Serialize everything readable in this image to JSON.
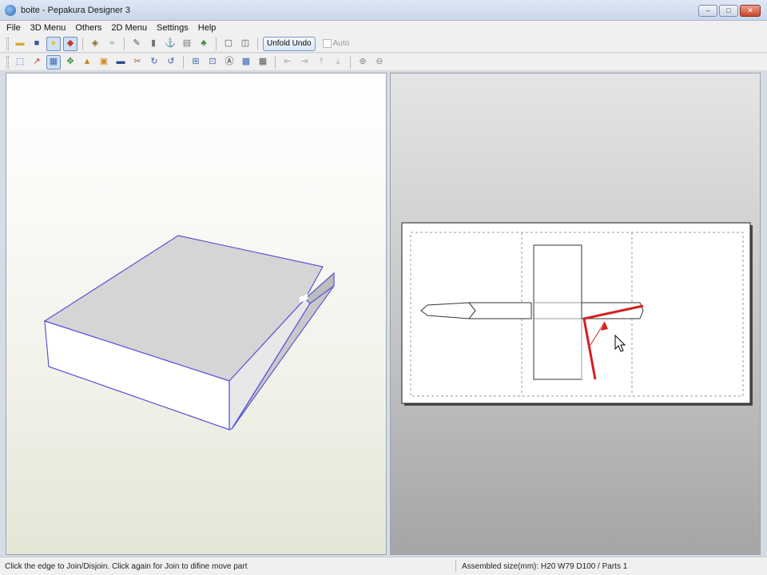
{
  "window": {
    "title": "boite - Pepakura Designer 3",
    "controls": {
      "minimize": "–",
      "maximize": "□",
      "close": "✕"
    }
  },
  "menu": [
    "File",
    "3D Menu",
    "Others",
    "2D Menu",
    "Settings",
    "Help"
  ],
  "toolbar1": {
    "icons": [
      "open-icon",
      "save-icon",
      "light-icon",
      "texture-icon",
      "fold-icon",
      "flap-icon",
      "edit-icon",
      "cylinder-icon",
      "anchor-icon",
      "piece-icon",
      "plant-icon",
      "view-single-icon",
      "view-split-icon"
    ],
    "unfold_undo_label": "Unfold Undo",
    "auto_label": "Auto"
  },
  "toolbar2": {
    "icons": [
      "select-icon",
      "join-icon",
      "move-icon",
      "rotate-icon",
      "paint-icon",
      "tab-icon",
      "color-icon",
      "cut-icon",
      "flip-icon",
      "redo-icon",
      "group-icon",
      "snap-icon",
      "text-icon",
      "image-icon",
      "grid-icon",
      "align-left-icon",
      "align-right-icon",
      "align-top-icon",
      "align-bottom-icon",
      "zoom-in-icon",
      "zoom-out-icon"
    ]
  },
  "colors": {
    "model_edge": "#5b56d6",
    "selected_edge": "#d42020",
    "fold_line": "#9a9a9a"
  },
  "status": {
    "left": "Click the edge to Join/Disjoin. Click again for Join to difine move part",
    "right": "Assembled size(mm): H20 W79 D100 / Parts 1"
  }
}
